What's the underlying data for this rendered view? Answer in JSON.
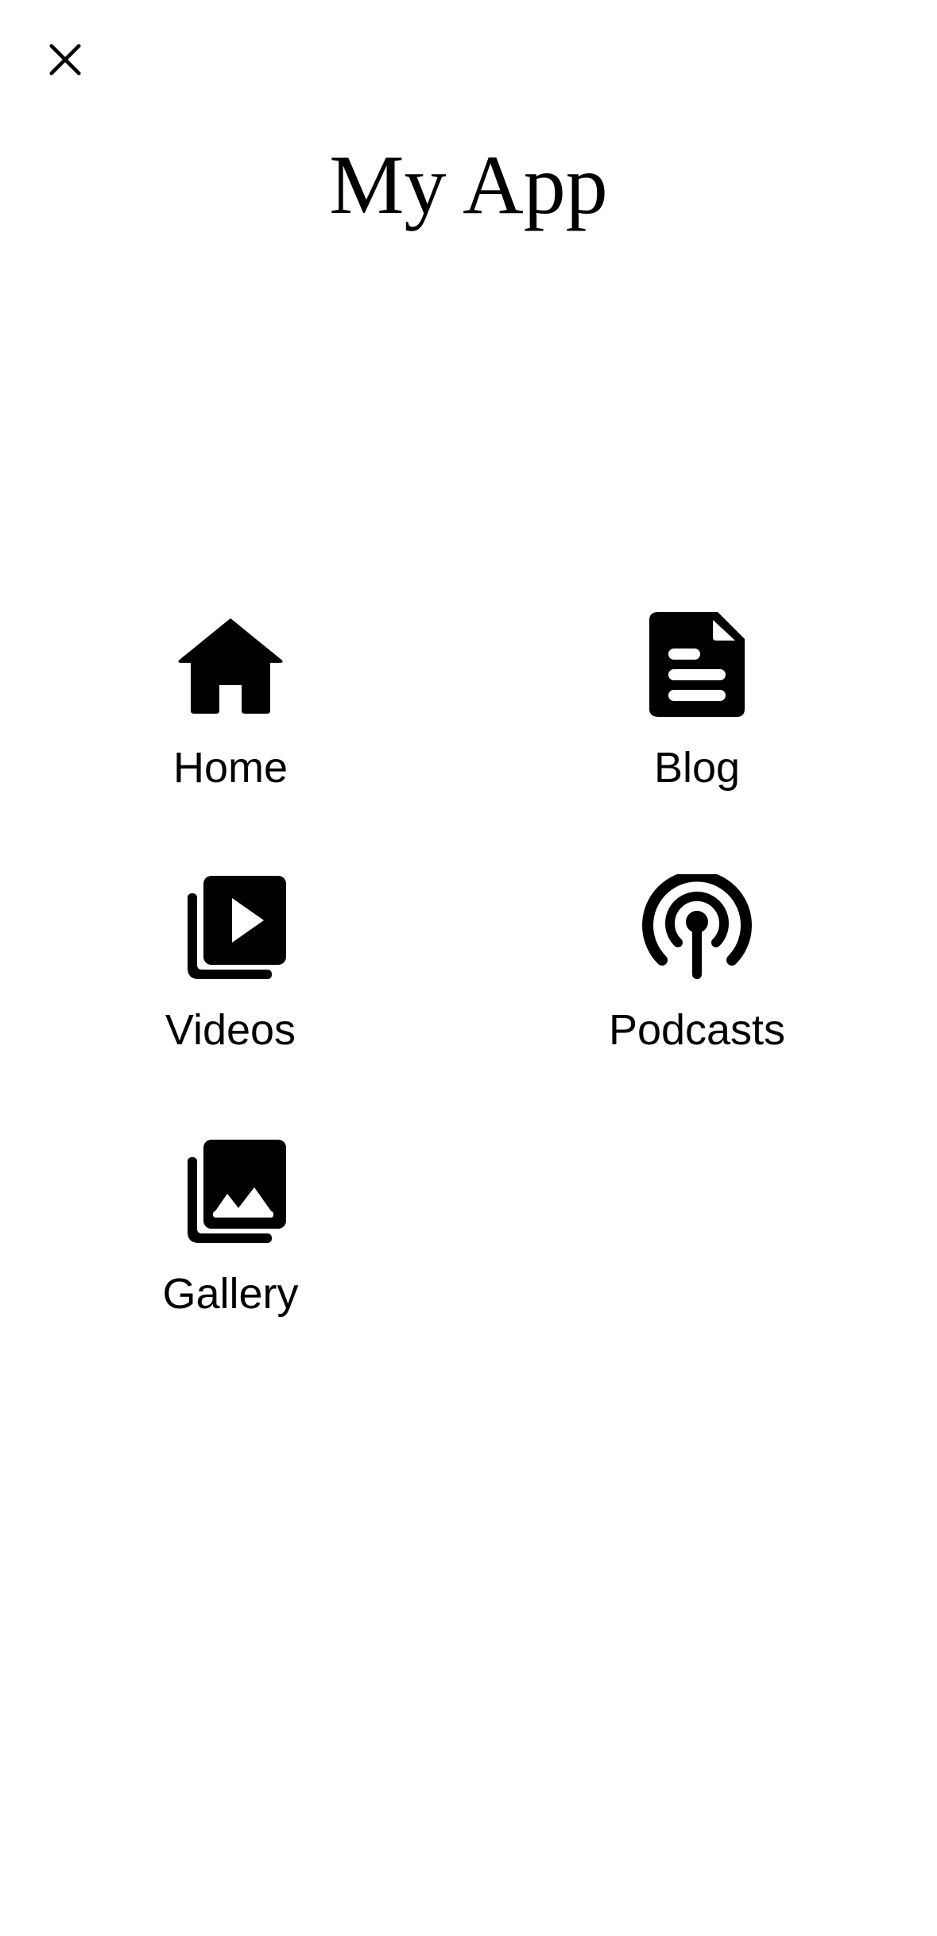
{
  "app": {
    "title": "My App",
    "close_icon": "close-icon"
  },
  "menu": {
    "items": [
      {
        "label": "Home",
        "icon": "home-icon"
      },
      {
        "label": "Blog",
        "icon": "document-icon"
      },
      {
        "label": "Videos",
        "icon": "video-library-icon"
      },
      {
        "label": "Podcasts",
        "icon": "podcast-icon"
      },
      {
        "label": "Gallery",
        "icon": "photo-library-icon"
      }
    ]
  },
  "colors": {
    "background": "#ffffff",
    "foreground": "#000000"
  }
}
